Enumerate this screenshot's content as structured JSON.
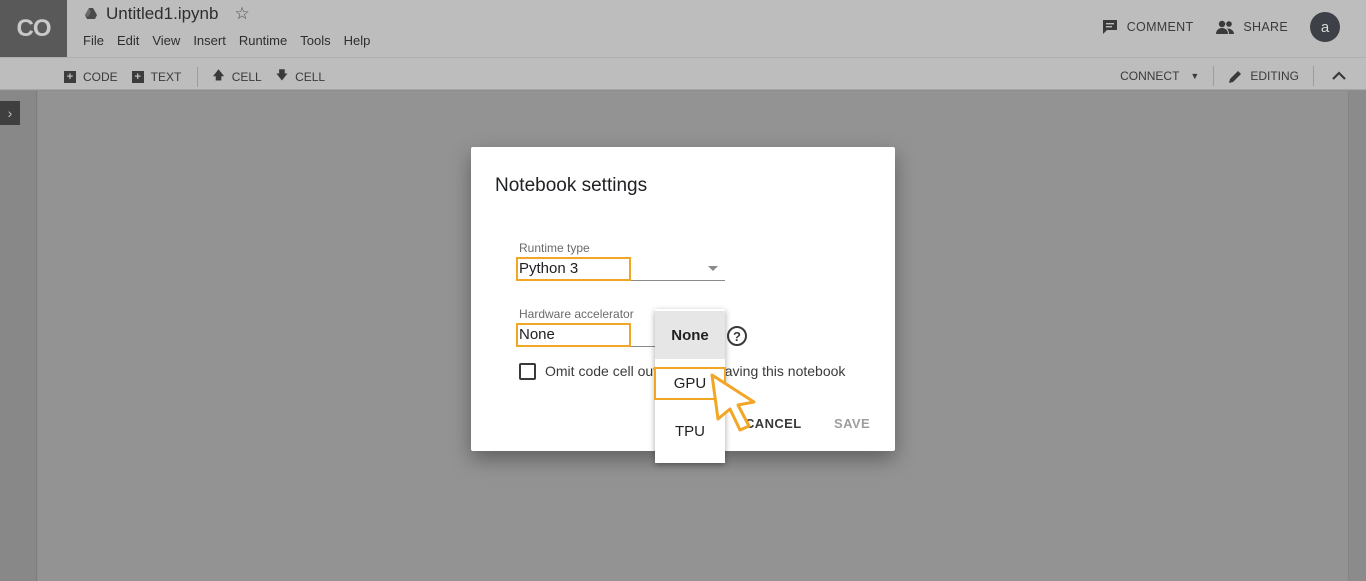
{
  "app": {
    "logo": "CO",
    "notebook_title": "Untitled1.ipynb",
    "menu": [
      "File",
      "Edit",
      "View",
      "Insert",
      "Runtime",
      "Tools",
      "Help"
    ],
    "comment_label": "COMMENT",
    "share_label": "SHARE",
    "avatar_letter": "a"
  },
  "toolbar": {
    "code_label": "CODE",
    "text_label": "TEXT",
    "cell_up_label": "CELL",
    "cell_down_label": "CELL",
    "connect_label": "CONNECT",
    "editing_label": "EDITING"
  },
  "dialog": {
    "title": "Notebook settings",
    "runtime_label": "Runtime type",
    "runtime_value": "Python 3",
    "accelerator_label": "Hardware accelerator",
    "accelerator_value": "None",
    "omit_text": "Omit code cell output when saving this notebook",
    "cancel_label": "CANCEL",
    "save_label": "SAVE"
  },
  "dropdown": {
    "options": [
      "None",
      "GPU",
      "TPU"
    ],
    "selected": "None",
    "hovered": "GPU"
  },
  "colors": {
    "highlight": "#f2a626",
    "overlay": "#939393"
  },
  "icons": [
    "drive-icon",
    "star-icon",
    "comment-icon",
    "share-icon",
    "plus-icon",
    "arrow-up-icon",
    "arrow-down-icon",
    "caret-down-icon",
    "pencil-icon",
    "chevron-up-icon",
    "chevron-right-icon",
    "help-icon",
    "pointer-cursor-icon"
  ]
}
